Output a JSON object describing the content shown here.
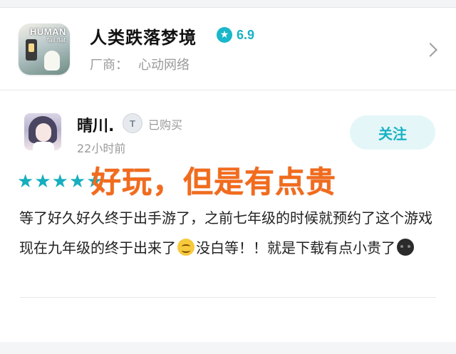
{
  "game": {
    "title": "人类跌落梦境",
    "score": "6.9",
    "vendor_label": "厂商：",
    "vendor_name": "心动网络"
  },
  "review": {
    "user_name": "晴川.",
    "badge_letter": "T",
    "purchased": "已购买",
    "time_ago": "22小时前",
    "follow_label": "关注",
    "rating_stars": 5,
    "headline": "好玩，但是有点贵",
    "body_part1": "等了好久好久终于出手游了，之前七年级的时候就预约了这个游戏现在九年级的终于出来了",
    "body_part2": "没白等！！就是下载有点小贵了"
  },
  "icons": {
    "score": "tap-star-icon",
    "chevron": "chevron-right-icon",
    "smile": "smile-emoji",
    "dark": "dark-face-emoji"
  },
  "colors": {
    "accent": "#18b2c4",
    "headline": "#f26b1d"
  }
}
